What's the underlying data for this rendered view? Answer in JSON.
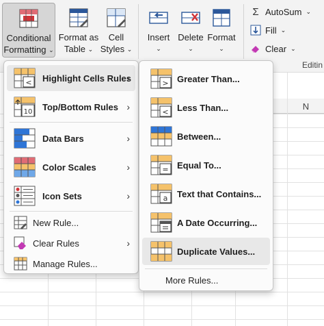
{
  "ribbon": {
    "conditional_formatting": {
      "line1": "Conditional",
      "line2": "Formatting"
    },
    "format_as_table": {
      "line1": "Format as",
      "line2": "Table"
    },
    "cell_styles": {
      "line1": "Cell",
      "line2": "Styles"
    },
    "insert": "Insert",
    "delete": "Delete",
    "format": "Format",
    "autosum": "AutoSum",
    "fill": "Fill",
    "clear": "Clear",
    "editing_group": "Editin",
    "chevron": "⌄",
    "colors": {
      "accent": "#2b579a",
      "red": "#d13438",
      "active_bg": "#d6d6d6"
    }
  },
  "sheet": {
    "column_n": "N"
  },
  "main_menu": {
    "items": [
      {
        "label": "Highlight Cells Rules",
        "icon": "highlight-cells-icon",
        "submenu": true,
        "highlighted": true
      },
      {
        "label": "Top/Bottom Rules",
        "icon": "top-bottom-icon",
        "submenu": true
      },
      {
        "label": "Data Bars",
        "icon": "data-bars-icon",
        "submenu": true
      },
      {
        "label": "Color Scales",
        "icon": "color-scales-icon",
        "submenu": true
      },
      {
        "label": "Icon Sets",
        "icon": "icon-sets-icon",
        "submenu": true
      },
      {
        "label": "New Rule...",
        "icon": "new-rule-icon"
      },
      {
        "label": "Clear Rules",
        "icon": "clear-rules-icon",
        "submenu": true
      },
      {
        "label": "Manage Rules...",
        "icon": "manage-rules-icon"
      }
    ],
    "arrow": "›"
  },
  "sub_menu": {
    "items": [
      {
        "label": "Greater Than...",
        "icon": "greater-than-icon"
      },
      {
        "label": "Less Than...",
        "icon": "less-than-icon"
      },
      {
        "label": "Between...",
        "icon": "between-icon"
      },
      {
        "label": "Equal To...",
        "icon": "equal-to-icon"
      },
      {
        "label": "Text that Contains...",
        "icon": "text-contains-icon"
      },
      {
        "label": "A Date Occurring...",
        "icon": "date-occurring-icon"
      },
      {
        "label": "Duplicate Values...",
        "icon": "duplicate-values-icon",
        "highlighted": true
      }
    ],
    "more_rules": "More Rules..."
  }
}
